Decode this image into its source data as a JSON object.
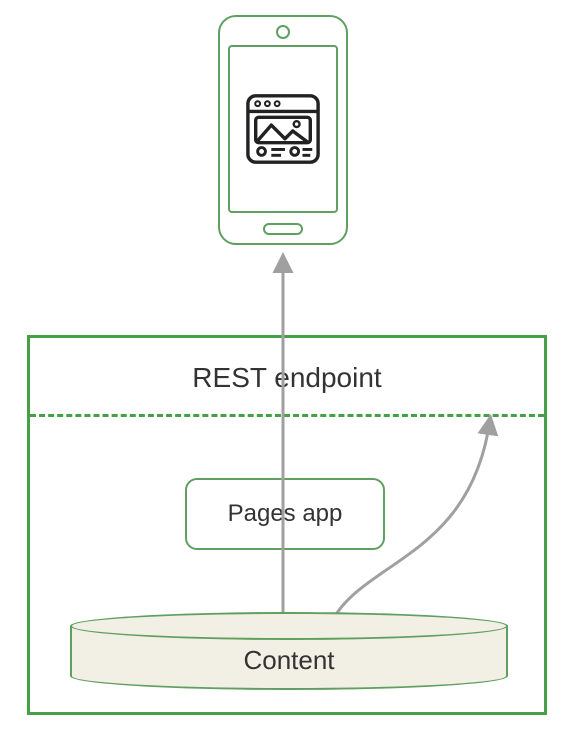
{
  "diagram": {
    "rest_endpoint_label": "REST endpoint",
    "pages_app_label": "Pages app",
    "content_label": "Content"
  },
  "colors": {
    "primary_green": "#46a046",
    "light_green": "#5f9f5f",
    "arrow_gray": "#a0a0a0",
    "icon_black": "#222222",
    "cylinder_fill": "#f2efe4"
  }
}
